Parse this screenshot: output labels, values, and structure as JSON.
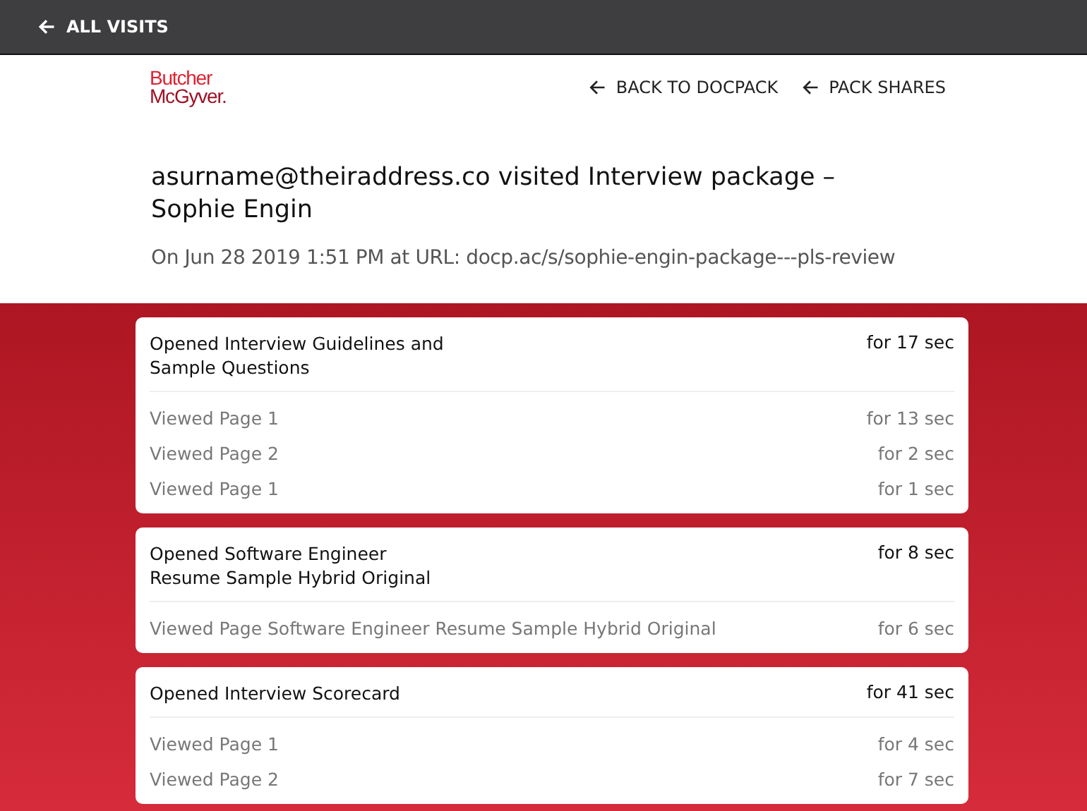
{
  "top_bar": {
    "back_label": "ALL VISITS"
  },
  "header": {
    "logo": [
      "Butcher",
      "McGyver."
    ],
    "links": [
      "BACK TO DOCPACK",
      "PACK SHARES"
    ]
  },
  "visit": {
    "title": "asurname@theiraddress.co visited Interview package – Sophie Engin",
    "subtitle": "On Jun 28 2019 1:51 PM at URL: docp.ac/s/sophie-engin-package---pls-review"
  },
  "documents": [
    {
      "title": "Opened Interview Guidelines and\nSample Questions",
      "duration": "for 17 sec",
      "pages": [
        {
          "label": "Viewed Page 1",
          "duration": "for 13 sec"
        },
        {
          "label": "Viewed Page 2",
          "duration": "for 2 sec"
        },
        {
          "label": "Viewed Page 1",
          "duration": "for 1 sec"
        }
      ]
    },
    {
      "title": "Opened Software Engineer\nResume Sample Hybrid Original",
      "duration": "for 8 sec",
      "pages": [
        {
          "label": "Viewed Page Software Engineer Resume Sample Hybrid Original",
          "duration": "for 6 sec"
        }
      ]
    },
    {
      "title": "Opened Interview Scorecard",
      "duration": "for 41 sec",
      "pages": [
        {
          "label": "Viewed Page 1",
          "duration": "for 4 sec"
        },
        {
          "label": "Viewed Page 2",
          "duration": "for 7 sec"
        }
      ]
    }
  ]
}
